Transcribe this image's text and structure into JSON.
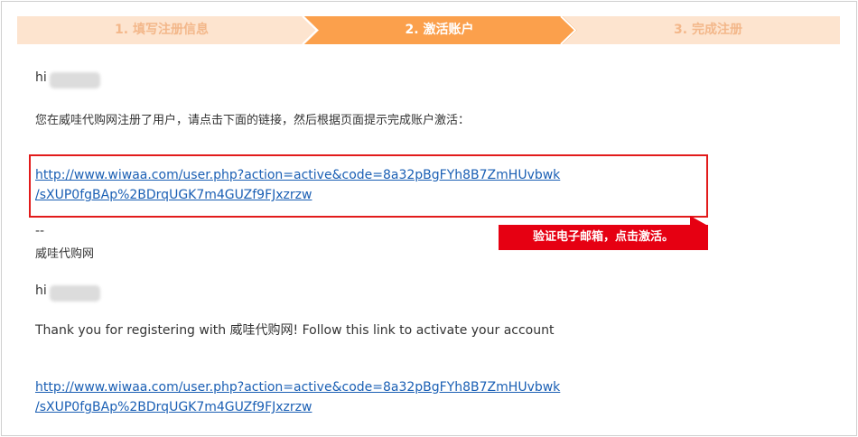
{
  "steps": [
    {
      "label": "1. 填写注册信息",
      "state": "completed"
    },
    {
      "label": "2. 激活账户",
      "state": "active"
    },
    {
      "label": "3. 完成注册",
      "state": "pending"
    }
  ],
  "colors": {
    "step_active": "#fba04c",
    "step_inactive": "#fde4cf",
    "step_inactive_text": "#f3b78a",
    "link": "#1a5fb4",
    "highlight": "#e21b1b",
    "callout_bg": "#e60012"
  },
  "email_cn": {
    "greeting": "hi",
    "body": "您在威哇代购网注册了用户，请点击下面的链接，然后根据页面提示完成账户激活：",
    "link_line1": "http://www.wiwaa.com/user.php?action=active&code=8a32pBgFYh8B7ZmHUvbwk",
    "link_line2": "/sXUP0fgBAp%2BDrqUGK7m4GUZf9FJxzrzw",
    "sig_dash": "--",
    "signature": "威哇代购网"
  },
  "email_en": {
    "greeting": "hi",
    "body": "Thank you for registering with 威哇代购网! Follow this link to activate your account",
    "link_line1": "http://www.wiwaa.com/user.php?action=active&code=8a32pBgFYh8B7ZmHUvbwk",
    "link_line2": "/sXUP0fgBAp%2BDrqUGK7m4GUZf9FJxzrzw"
  },
  "callout": {
    "text": "验证电子邮箱，点击激活。"
  }
}
